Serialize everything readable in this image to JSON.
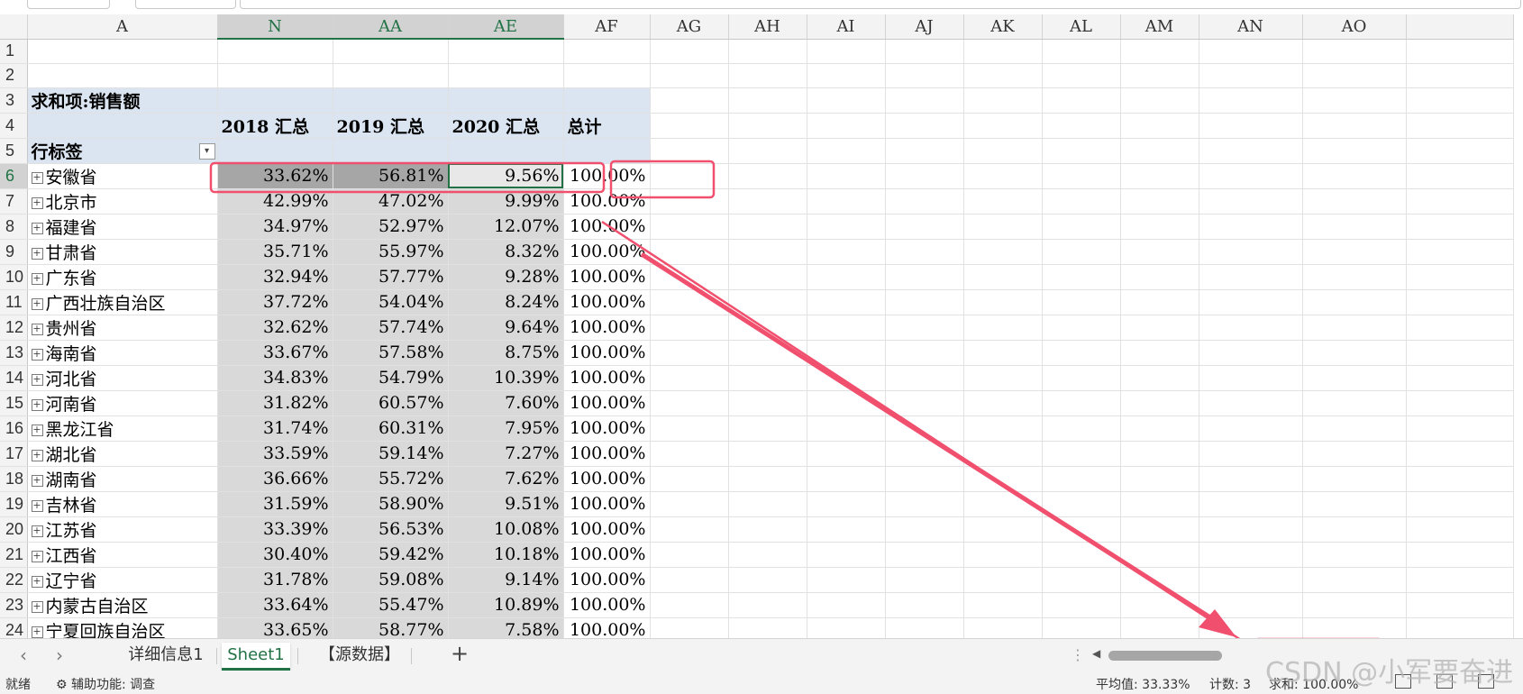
{
  "columns": [
    "A",
    "N",
    "AA",
    "AE",
    "AF",
    "AG",
    "AH",
    "AI",
    "AJ",
    "AK",
    "AL",
    "AM",
    "AN",
    "AO"
  ],
  "pivot": {
    "title": "求和项:销售额",
    "col_headers": [
      "2018 汇总",
      "2019 汇总",
      "2020 汇总",
      "总计"
    ],
    "row_label": "行标签",
    "rows": [
      {
        "name": "安徽省",
        "v": [
          "33.62%",
          "56.81%",
          "9.56%",
          "100.00%"
        ]
      },
      {
        "name": "北京市",
        "v": [
          "42.99%",
          "47.02%",
          "9.99%",
          "100.00%"
        ]
      },
      {
        "name": "福建省",
        "v": [
          "34.97%",
          "52.97%",
          "12.07%",
          "100.00%"
        ]
      },
      {
        "name": "甘肃省",
        "v": [
          "35.71%",
          "55.97%",
          "8.32%",
          "100.00%"
        ]
      },
      {
        "name": "广东省",
        "v": [
          "32.94%",
          "57.77%",
          "9.28%",
          "100.00%"
        ]
      },
      {
        "name": "广西壮族自治区",
        "v": [
          "37.72%",
          "54.04%",
          "8.24%",
          "100.00%"
        ]
      },
      {
        "name": "贵州省",
        "v": [
          "32.62%",
          "57.74%",
          "9.64%",
          "100.00%"
        ]
      },
      {
        "name": "海南省",
        "v": [
          "33.67%",
          "57.58%",
          "8.75%",
          "100.00%"
        ]
      },
      {
        "name": "河北省",
        "v": [
          "34.83%",
          "54.79%",
          "10.39%",
          "100.00%"
        ]
      },
      {
        "name": "河南省",
        "v": [
          "31.82%",
          "60.57%",
          "7.60%",
          "100.00%"
        ]
      },
      {
        "name": "黑龙江省",
        "v": [
          "31.74%",
          "60.31%",
          "7.95%",
          "100.00%"
        ]
      },
      {
        "name": "湖北省",
        "v": [
          "33.59%",
          "59.14%",
          "7.27%",
          "100.00%"
        ]
      },
      {
        "name": "湖南省",
        "v": [
          "36.66%",
          "55.72%",
          "7.62%",
          "100.00%"
        ]
      },
      {
        "name": "吉林省",
        "v": [
          "31.59%",
          "58.90%",
          "9.51%",
          "100.00%"
        ]
      },
      {
        "name": "江苏省",
        "v": [
          "33.39%",
          "56.53%",
          "10.08%",
          "100.00%"
        ]
      },
      {
        "name": "江西省",
        "v": [
          "30.40%",
          "59.42%",
          "10.18%",
          "100.00%"
        ]
      },
      {
        "name": "辽宁省",
        "v": [
          "31.78%",
          "59.08%",
          "9.14%",
          "100.00%"
        ]
      },
      {
        "name": "内蒙古自治区",
        "v": [
          "33.64%",
          "55.47%",
          "10.89%",
          "100.00%"
        ]
      },
      {
        "name": "宁夏回族自治区",
        "v": [
          "33.65%",
          "58.77%",
          "7.58%",
          "100.00%"
        ]
      }
    ]
  },
  "tabs": {
    "prev_icon": "‹",
    "next_icon": "›",
    "items": [
      "详细信息1",
      "Sheet1",
      "【源数据】"
    ],
    "active": "Sheet1",
    "add": "+"
  },
  "status": {
    "ready": "就绪",
    "accessibility": "辅助功能: 调查",
    "average": "平均值: 33.33%",
    "count": "计数: 3",
    "sum": "求和: 100.00%"
  },
  "watermark": "CSDN @小军要奋进",
  "colors": {
    "annotation": "#f0506e",
    "accent": "#217346",
    "pivot_header": "#dbe5f1",
    "selection": "#d9d9d9"
  }
}
